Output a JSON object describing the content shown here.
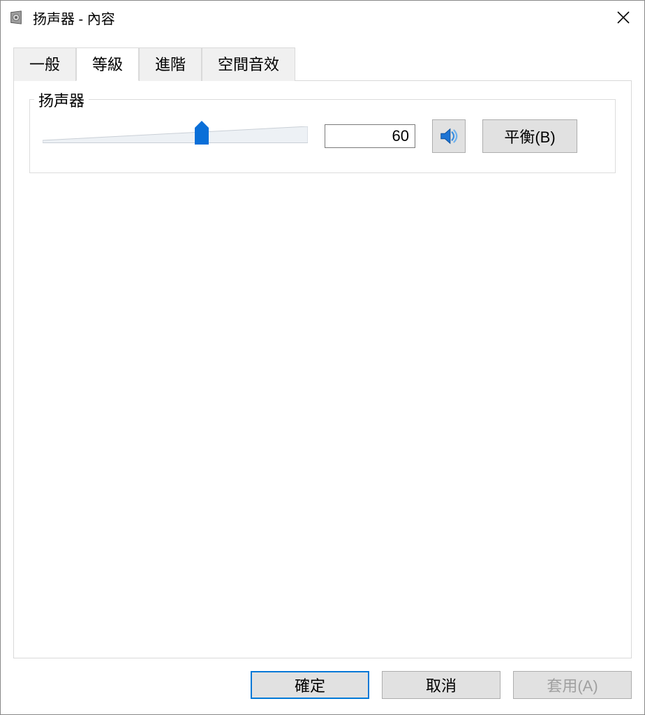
{
  "window": {
    "title": "扬声器 - 內容"
  },
  "tabs": [
    {
      "label": "一般",
      "active": false
    },
    {
      "label": "等級",
      "active": true
    },
    {
      "label": "進階",
      "active": false
    },
    {
      "label": "空間音效",
      "active": false
    }
  ],
  "levels": {
    "group_title": "扬声器",
    "volume": 60,
    "slider_min": 0,
    "slider_max": 100,
    "balance_label": "平衡(B)",
    "mute_icon": "speaker-icon"
  },
  "footer": {
    "ok": "確定",
    "cancel": "取消",
    "apply": "套用(A)",
    "apply_enabled": false
  }
}
